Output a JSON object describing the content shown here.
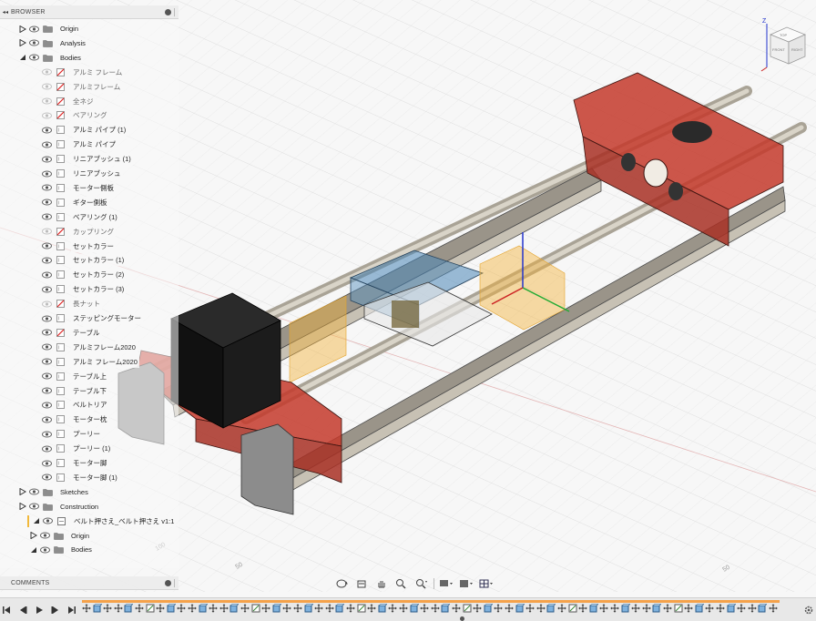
{
  "browser": {
    "title": "BROWSER",
    "collapse_glyph": "◂◂",
    "rows": [
      {
        "label": "Origin",
        "kind": "folder",
        "expander": "closed",
        "depth": 0,
        "visible": true
      },
      {
        "label": "Analysis",
        "kind": "folder",
        "expander": "closed",
        "depth": 0,
        "visible": true
      },
      {
        "label": "Bodies",
        "kind": "folder",
        "expander": "open",
        "depth": 0,
        "visible": true
      },
      {
        "label": "アルミ フレーム",
        "kind": "body-red",
        "depth": 1,
        "visible": false
      },
      {
        "label": "アルミフレーム",
        "kind": "body-red",
        "depth": 1,
        "visible": false
      },
      {
        "label": "全ネジ",
        "kind": "body-red",
        "depth": 1,
        "visible": false
      },
      {
        "label": "ベアリング",
        "kind": "body-red",
        "depth": 1,
        "visible": false
      },
      {
        "label": "アルミ パイプ (1)",
        "kind": "body",
        "depth": 1,
        "visible": true
      },
      {
        "label": "アルミ パイプ",
        "kind": "body",
        "depth": 1,
        "visible": true
      },
      {
        "label": "リニアブッシュ (1)",
        "kind": "body",
        "depth": 1,
        "visible": true
      },
      {
        "label": "リニアブッシュ",
        "kind": "body",
        "depth": 1,
        "visible": true
      },
      {
        "label": "モーター側板",
        "kind": "body",
        "depth": 1,
        "visible": true
      },
      {
        "label": "ギター側板",
        "kind": "body",
        "depth": 1,
        "visible": true
      },
      {
        "label": "ベアリング (1)",
        "kind": "body",
        "depth": 1,
        "visible": true
      },
      {
        "label": "カップリング",
        "kind": "body-red",
        "depth": 1,
        "visible": false
      },
      {
        "label": "セットカラー",
        "kind": "body",
        "depth": 1,
        "visible": true
      },
      {
        "label": "セットカラー (1)",
        "kind": "body",
        "depth": 1,
        "visible": true
      },
      {
        "label": "セットカラー (2)",
        "kind": "body",
        "depth": 1,
        "visible": true
      },
      {
        "label": "セットカラー (3)",
        "kind": "body",
        "depth": 1,
        "visible": true
      },
      {
        "label": "長ナット",
        "kind": "body-red",
        "depth": 1,
        "visible": false
      },
      {
        "label": "ステッピングモーター",
        "kind": "body",
        "depth": 1,
        "visible": true
      },
      {
        "label": "テーブル",
        "kind": "body-red",
        "depth": 1,
        "visible": true
      },
      {
        "label": "アルミフレーム2020",
        "kind": "body",
        "depth": 1,
        "visible": true
      },
      {
        "label": "アルミ フレーム2020",
        "kind": "body",
        "depth": 1,
        "visible": true
      },
      {
        "label": "テーブル上",
        "kind": "body",
        "depth": 1,
        "visible": true
      },
      {
        "label": "テーブル下",
        "kind": "body",
        "depth": 1,
        "visible": true
      },
      {
        "label": "ベルトリア",
        "kind": "body",
        "depth": 1,
        "visible": true
      },
      {
        "label": "モーター枕",
        "kind": "body",
        "depth": 1,
        "visible": true
      },
      {
        "label": "プーリー",
        "kind": "body",
        "depth": 1,
        "visible": true
      },
      {
        "label": "プーリー (1)",
        "kind": "body",
        "depth": 1,
        "visible": true
      },
      {
        "label": "モーター脚",
        "kind": "body",
        "depth": 1,
        "visible": true
      },
      {
        "label": "モーター脚 (1)",
        "kind": "body",
        "depth": 1,
        "visible": true
      },
      {
        "label": "Sketches",
        "kind": "folder",
        "expander": "closed",
        "depth": 0,
        "visible": true
      },
      {
        "label": "Construction",
        "kind": "folder",
        "expander": "closed",
        "depth": 0,
        "visible": true
      },
      {
        "label": "ベルト押さえ_ベルト押さえ v1:1",
        "kind": "component",
        "expander": "open",
        "depth": 0,
        "visible": true
      },
      {
        "label": "Origin",
        "kind": "folder",
        "expander": "closed",
        "depth": 1,
        "visible": true
      },
      {
        "label": "Bodies",
        "kind": "folder",
        "expander": "open",
        "depth": 1,
        "visible": true
      }
    ]
  },
  "comments": {
    "title": "COMMENTS"
  },
  "navbar": {
    "buttons": [
      "orbit-icon",
      "look-at-icon",
      "pan-icon",
      "zoom-icon",
      "fit-icon",
      "display-settings-icon",
      "grid-settings-icon",
      "viewports-icon"
    ]
  },
  "viewcube": {
    "top": "TOP",
    "front": "FRONT",
    "right": "RIGHT",
    "z": "Z"
  },
  "grid_labels": [
    "100",
    "50",
    "50"
  ],
  "timeline": {
    "controls": [
      "first-step-icon",
      "previous-step-icon",
      "play-icon",
      "next-step-icon",
      "last-step-icon"
    ],
    "feature_count": 66
  },
  "colors": {
    "accent_red": "#c4392b",
    "rail": "#b9b3a6",
    "motor": "#1a1a1a",
    "highlight": "#f2b23a",
    "selection_blue": "#4b87b8",
    "timeline_track": "#f5a24a"
  }
}
